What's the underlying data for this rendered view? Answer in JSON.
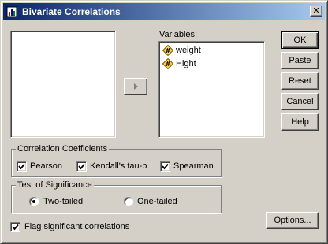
{
  "window": {
    "title": "Bivariate Correlations",
    "close_glyph": "✕"
  },
  "source_list": {
    "items": []
  },
  "move_button": {
    "icon": "right-arrow-icon"
  },
  "variables": {
    "label": "Variables:",
    "items": [
      {
        "name": "weight",
        "icon": "numeric-scale-icon"
      },
      {
        "name": "Hight",
        "icon": "numeric-scale-icon"
      }
    ]
  },
  "buttons": {
    "ok": "OK",
    "paste": "Paste",
    "reset": "Reset",
    "cancel": "Cancel",
    "help": "Help",
    "options": "Options..."
  },
  "coefficients": {
    "legend": "Correlation Coefficients",
    "pearson": {
      "label": "Pearson",
      "checked": true
    },
    "kendall": {
      "label": "Kendall's tau-b",
      "checked": true
    },
    "spearman": {
      "label": "Spearman",
      "checked": true
    }
  },
  "significance": {
    "legend": "Test of Significance",
    "two_tailed": {
      "label": "Two-tailed",
      "selected": true
    },
    "one_tailed": {
      "label": "One-tailed",
      "selected": false
    }
  },
  "flag": {
    "label": "Flag significant correlations",
    "checked": true
  }
}
